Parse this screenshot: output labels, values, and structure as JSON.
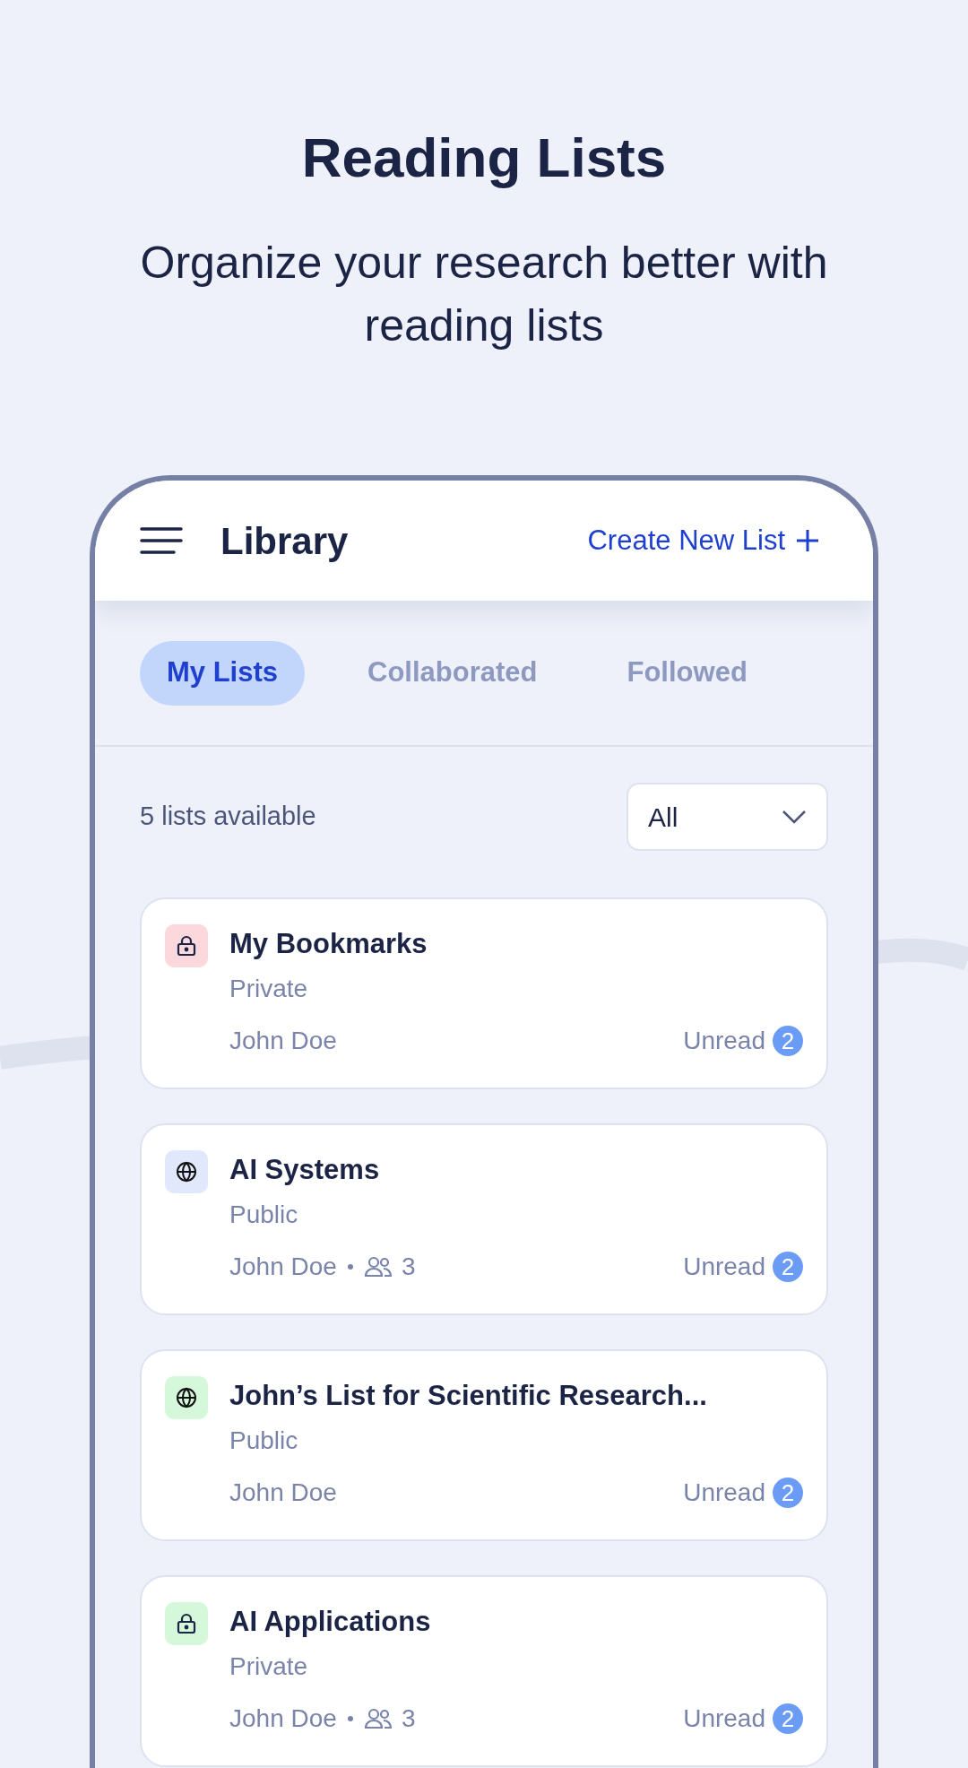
{
  "headline": "Reading Lists",
  "subheadline": "Organize your research better with reading lists",
  "header": {
    "title": "Library",
    "action": "Create New List"
  },
  "tabs": [
    {
      "label": "My Lists",
      "selected": true
    },
    {
      "label": "Collaborated",
      "selected": false
    },
    {
      "label": "Followed",
      "selected": false
    }
  ],
  "count_label": "5 lists available",
  "filter": {
    "value": "All"
  },
  "lists": [
    {
      "title": "My Bookmarks",
      "kind": "lock",
      "color": "#fbd8dc",
      "visibility": "Private",
      "owner": "John Doe",
      "unread_label": "Unread",
      "unread": "2"
    },
    {
      "title": "AI Systems",
      "kind": "globe",
      "color": "#e1e8fb",
      "visibility": "Public",
      "owner": "John Doe",
      "members": "3",
      "unread_label": "Unread",
      "unread": "2"
    },
    {
      "title": "John’s List for Scientific Research...",
      "kind": "globe",
      "color": "#d6f8da",
      "visibility": "Public",
      "owner": "John Doe",
      "unread_label": "Unread",
      "unread": "2"
    },
    {
      "title": "AI Applications",
      "kind": "lock",
      "color": "#d6f8da",
      "visibility": "Private",
      "owner": "John Doe",
      "members": "3",
      "unread_label": "Unread",
      "unread": "2"
    }
  ]
}
